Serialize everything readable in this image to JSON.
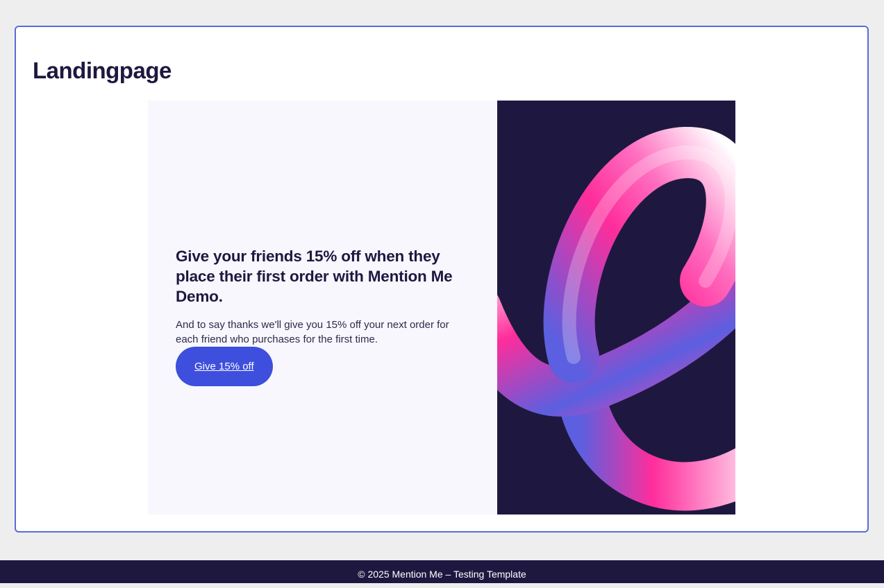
{
  "page": {
    "title": "Landingpage"
  },
  "banner": {
    "headline": "Give your friends 15% off when they place their first order with Mention Me Demo.",
    "body": "And to say thanks we'll give you 15% off your next order for each friend who purchases for the first time.",
    "cta_label": "Give 15% off",
    "art_icon": "ribbon-loop-illustration"
  },
  "footer": {
    "text": "© 2025 Mention Me – Testing Template"
  },
  "colors": {
    "navy": "#1e1840",
    "accent_blue": "#3d4fdc",
    "frame_border": "#5b6ad9",
    "panel_bg": "#f7f7fd",
    "pink": "#ff2d9b"
  }
}
